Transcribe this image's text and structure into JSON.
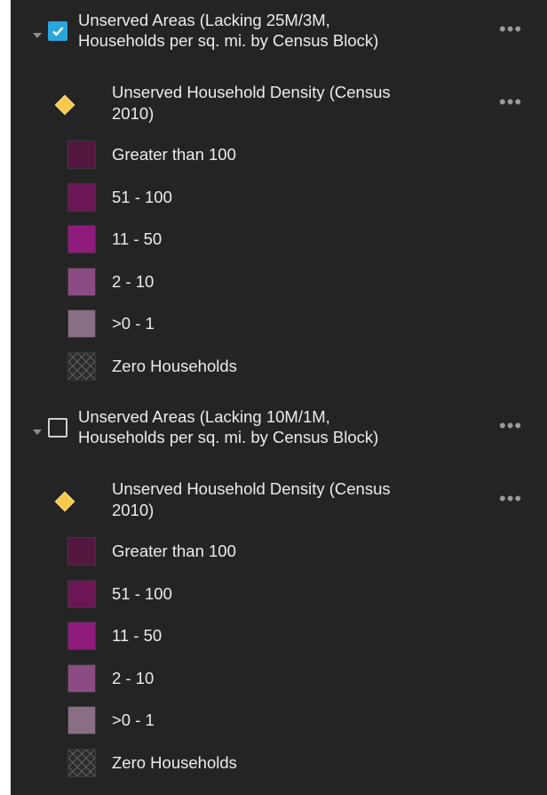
{
  "layers": [
    {
      "title_line1": "Unserved Areas (Lacking 25M/3M,",
      "title_line2": "Households per sq. mi. by Census Block)",
      "checked": true,
      "sublayer": {
        "title_line1": "Unserved Household Density (Census",
        "title_line2": "2010)"
      },
      "legend": [
        {
          "label": "Greater than 100",
          "color": "#541740"
        },
        {
          "label": "51 - 100",
          "color": "#6b1755"
        },
        {
          "label": "11 - 50",
          "color": "#8f1b7d"
        },
        {
          "label": "2 - 10",
          "color": "#8c4b82"
        },
        {
          "label": ">0 - 1",
          "color": "#8a6f84"
        },
        {
          "label": "Zero Households",
          "color": "hatch"
        }
      ]
    },
    {
      "title_line1": "Unserved Areas (Lacking 10M/1M,",
      "title_line2": "Households per sq. mi. by Census Block)",
      "checked": false,
      "sublayer": {
        "title_line1": "Unserved Household Density (Census",
        "title_line2": "2010)"
      },
      "legend": [
        {
          "label": "Greater than 100",
          "color": "#541740"
        },
        {
          "label": "51 - 100",
          "color": "#6b1755"
        },
        {
          "label": "11 - 50",
          "color": "#8f1b7d"
        },
        {
          "label": "2 - 10",
          "color": "#8c4b82"
        },
        {
          "label": ">0 - 1",
          "color": "#8a6f84"
        },
        {
          "label": "Zero Households",
          "color": "hatch"
        }
      ]
    }
  ],
  "icons": {
    "expand": "caret-down-icon",
    "visibility": "checkbox",
    "sublayer": "diamond-point-icon",
    "options": "more-options-icon"
  },
  "colors": {
    "panel_background": "#242424",
    "checkbox_checked": "#2aa6dc",
    "diamond": "#f7c84a"
  }
}
